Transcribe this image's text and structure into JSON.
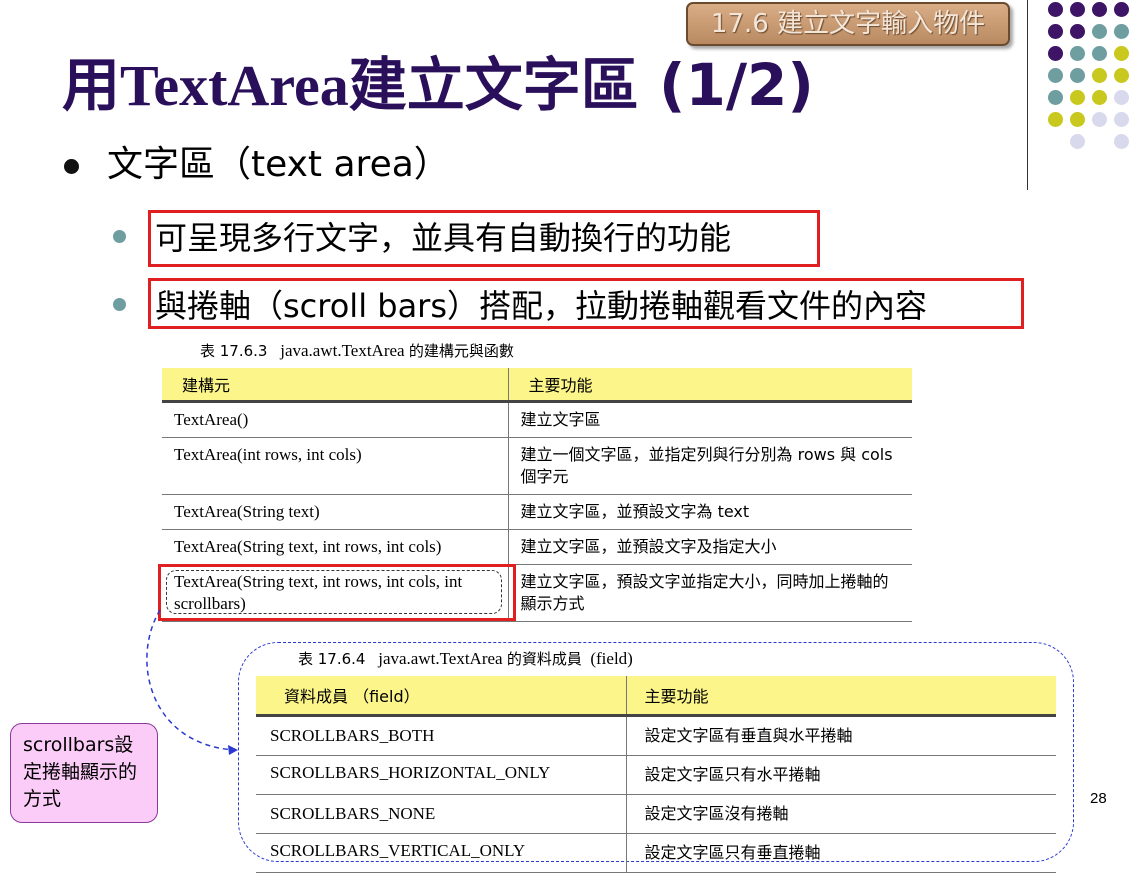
{
  "section_tag": "17.6 建立文字輸入物件",
  "title": {
    "prefix": "用",
    "latin": "TextArea",
    "suffix": "建立文字區 (1/2)"
  },
  "bullet": "文字區（text area）",
  "sub_bullets": [
    "可呈現多行文字，並具有自動換行的功能",
    "與捲軸（scroll bars）搭配，拉動捲軸觀看文件的內容"
  ],
  "table1": {
    "caption_num": "表 17.6.3",
    "caption_class": "java.awt.TextArea",
    "caption_text": "的建構元與函數",
    "headers": [
      "建構元",
      "主要功能"
    ],
    "rows": [
      [
        "TextArea()",
        "建立文字區"
      ],
      [
        "TextArea(int rows, int cols)",
        "建立一個文字區，並指定列與行分別為 rows 與 cols 個字元"
      ],
      [
        "TextArea(String text)",
        "建立文字區，並預設文字為 text"
      ],
      [
        "TextArea(String text, int rows, int cols)",
        "建立文字區，並預設文字及指定大小"
      ],
      [
        "TextArea(String text, int rows, int cols, int scrollbars)",
        "建立文字區，預設文字並指定大小，同時加上捲軸的顯示方式"
      ]
    ]
  },
  "table2": {
    "caption_num": "表 17.6.4",
    "caption_class": "java.awt.TextArea",
    "caption_text": "的資料成員",
    "caption_tail": "(field)",
    "headers": [
      "資料成員 （field）",
      "主要功能"
    ],
    "rows": [
      [
        "SCROLLBARS_BOTH",
        "設定文字區有垂直與水平捲軸"
      ],
      [
        "SCROLLBARS_HORIZONTAL_ONLY",
        "設定文字區只有水平捲軸"
      ],
      [
        "SCROLLBARS_NONE",
        "設定文字區沒有捲軸"
      ],
      [
        "SCROLLBARS_VERTICAL_ONLY",
        "設定文字區只有垂直捲軸"
      ]
    ]
  },
  "callout": "scrollbars設定捲軸顯示的方式",
  "page_number": "28",
  "colors": {
    "title": "#2a0f5a",
    "header_fill": "#fbf58a",
    "highlight": "#e02020",
    "dot_purple": "#3d1466",
    "dot_teal": "#6f9ea0",
    "dot_yellow": "#c8c81e",
    "dot_lavender": "#d9d9ee"
  }
}
